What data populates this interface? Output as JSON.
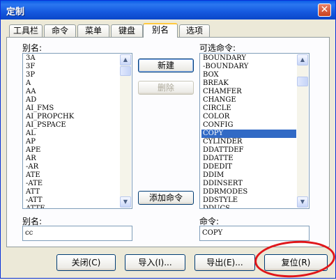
{
  "window": {
    "title": "定制",
    "close_glyph": "✕"
  },
  "tabs": [
    {
      "label": "工具栏",
      "active": false
    },
    {
      "label": "命令",
      "active": false
    },
    {
      "label": "菜单",
      "active": false
    },
    {
      "label": "键盘",
      "active": false
    },
    {
      "label": "别名",
      "active": true
    },
    {
      "label": "选项",
      "active": false
    }
  ],
  "alias_panel": {
    "aliases_label": "别名:",
    "aliases": [
      "3A",
      "3F",
      "3P",
      "A",
      "AA",
      "AD",
      "AI_FMS",
      "AI_PROPCHK",
      "AI_PSPACE",
      "AL",
      "AP",
      "APE",
      "AR",
      "-AR",
      "ATE",
      "-ATE",
      "ATT",
      "-ATT",
      "ATTE"
    ],
    "available_label": "可选命令:",
    "commands": [
      "BOUNDARY",
      "-BOUNDARY",
      "BOX",
      "BREAK",
      "CHAMFER",
      "CHANGE",
      "CIRCLE",
      "COLOR",
      "CONFIG",
      "COPY",
      "CYLINDER",
      "DDATTDEF",
      "DDATTE",
      "DDEDIT",
      "DDIM",
      "DDINSERT",
      "DDRMODES",
      "DDSTYLE",
      "DDUCS"
    ],
    "selected_command": "COPY",
    "new_button": "新建",
    "delete_button": "删除",
    "add_command_button": "添加命令",
    "alias_field_label": "别名:",
    "alias_value": "cc",
    "command_field_label": "命令:",
    "command_value": "COPY"
  },
  "footer": {
    "close_button": "关闭(C)",
    "import_button": "导入(I)...",
    "export_button": "导出(E)...",
    "reset_button": "复位(R)"
  },
  "colors": {
    "titlebar": "#0a5be6",
    "selection": "#316ac5",
    "annotation": "#e0161a"
  }
}
